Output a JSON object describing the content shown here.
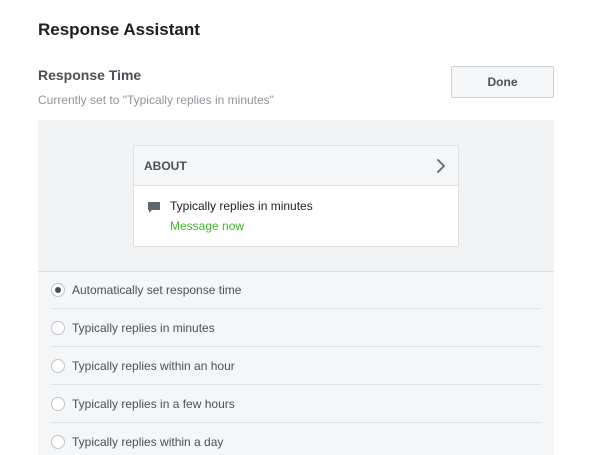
{
  "header": {
    "title": "Response Assistant"
  },
  "section": {
    "title": "Response Time",
    "subtitle": "Currently set to \"Typically replies in minutes\"",
    "done_label": "Done"
  },
  "preview_card": {
    "header_label": "ABOUT",
    "header_icon": "chevron-right-icon",
    "status_icon": "speech-bubble-icon",
    "status_text": "Typically replies in minutes",
    "link_text": "Message now",
    "link_color": "#42b72a"
  },
  "options": [
    {
      "label": "Automatically set response time",
      "selected": true
    },
    {
      "label": "Typically replies in minutes",
      "selected": false
    },
    {
      "label": "Typically replies within an hour",
      "selected": false
    },
    {
      "label": "Typically replies in a few hours",
      "selected": false
    },
    {
      "label": "Typically replies within a day",
      "selected": false
    }
  ]
}
